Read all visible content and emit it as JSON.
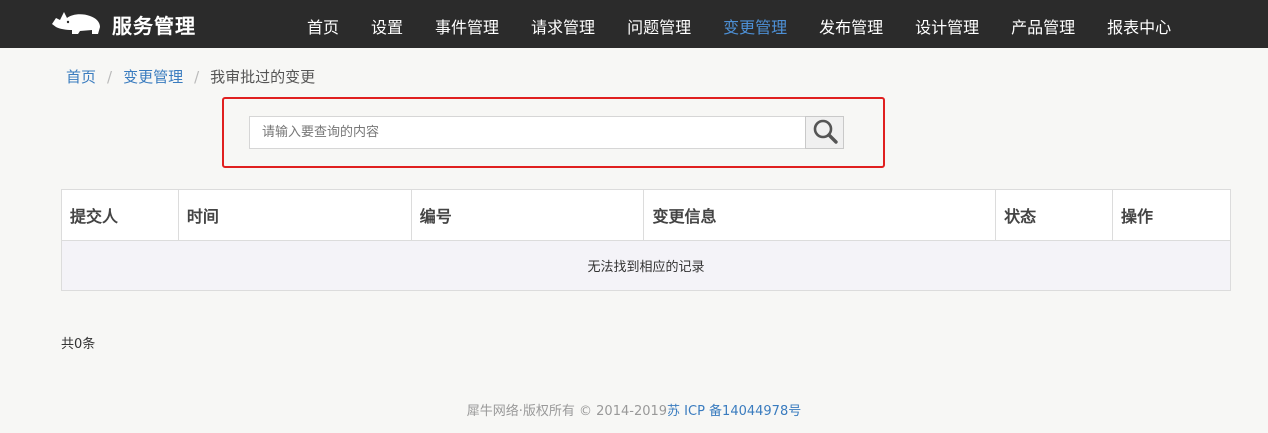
{
  "header": {
    "brand": "服务管理",
    "nav": [
      {
        "label": "首页",
        "active": false
      },
      {
        "label": "设置",
        "active": false
      },
      {
        "label": "事件管理",
        "active": false
      },
      {
        "label": "请求管理",
        "active": false
      },
      {
        "label": "问题管理",
        "active": false
      },
      {
        "label": "变更管理",
        "active": true
      },
      {
        "label": "发布管理",
        "active": false
      },
      {
        "label": "设计管理",
        "active": false
      },
      {
        "label": "产品管理",
        "active": false
      },
      {
        "label": "报表中心",
        "active": false
      }
    ]
  },
  "breadcrumb": {
    "home": "首页",
    "section": "变更管理",
    "current": "我审批过的变更",
    "separator": "/"
  },
  "search": {
    "placeholder": "请输入要查询的内容",
    "value": ""
  },
  "table": {
    "columns": [
      "提交人",
      "时间",
      "编号",
      "变更信息",
      "状态",
      "操作"
    ],
    "empty_text": "无法找到相应的记录"
  },
  "pagination": {
    "total_text": "共0条"
  },
  "footer": {
    "copyright": "犀牛网络·版权所有 © 2014-2019",
    "icp": "苏 ICP 备14044978号"
  },
  "colors": {
    "navbar_bg": "#2b2b2b",
    "active_nav": "#4d90d6",
    "link": "#3a7cbf",
    "highlight_border": "#e02020"
  }
}
